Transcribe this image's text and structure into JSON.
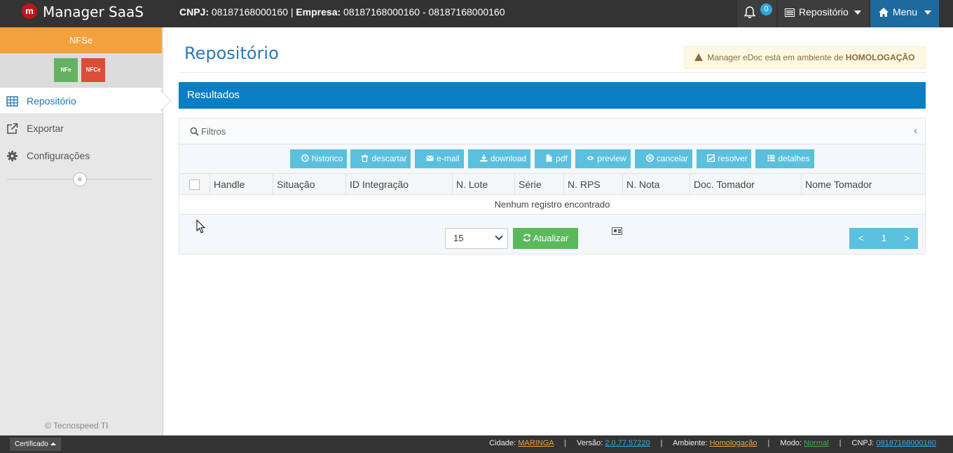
{
  "topbar": {
    "logo_letter": "m",
    "app_title": "Manager SaaS",
    "cnpj_label": "CNPJ:",
    "cnpj_value": "08187168000160",
    "separator": "|",
    "company_label": "Empresa:",
    "company_value": "08187168000160 - 08187168000160",
    "notification_count": "0",
    "repo_label": "Repositório",
    "menu_label": "Menu"
  },
  "sidebar": {
    "doc_type": "NFSe",
    "doc_buttons": [
      {
        "label": "NFe",
        "color": "#62b262"
      },
      {
        "label": "NFCe",
        "color": "#dd4b39"
      }
    ],
    "items": [
      {
        "label": "Repositório",
        "icon": "table-icon",
        "active": true
      },
      {
        "label": "Exportar",
        "icon": "external-link-icon",
        "active": false
      },
      {
        "label": "Configurações",
        "icon": "gear-icon",
        "active": false
      }
    ],
    "collapse_glyph": "«",
    "footer": "© Tecnospeed TI"
  },
  "main": {
    "page_title": "Repositório",
    "env_alert": {
      "text": "Manager eDoc está em ambiente de",
      "highlight": "HOMOLOGAÇÃO"
    },
    "panel_title": "Resultados",
    "filters_label": "Filtros",
    "filters_chevron": "‹",
    "actions": [
      {
        "label": "historico",
        "icon": "clock-icon"
      },
      {
        "label": "descartar",
        "icon": "trash-icon"
      },
      {
        "label": "e-mail",
        "icon": "envelope-icon"
      },
      {
        "label": "download",
        "icon": "download-icon"
      },
      {
        "label": "pdf",
        "icon": "file-icon"
      },
      {
        "label": "preview",
        "icon": "eye-icon"
      },
      {
        "label": "cancelar",
        "icon": "times-circle-icon"
      },
      {
        "label": "resolver",
        "icon": "check-square-icon"
      },
      {
        "label": "detalhes",
        "icon": "list-icon"
      }
    ],
    "columns": [
      "Handle",
      "Situação",
      "ID Integração",
      "N. Lote",
      "Série",
      "N. RPS",
      "N. Nota",
      "Doc. Tomador",
      "Nome Tomador"
    ],
    "empty_message": "Nenhum registro encontrado",
    "page_size": "15",
    "refresh_label": "Atualizar",
    "pagination": {
      "prev": "<",
      "current": "1",
      "next": ">"
    }
  },
  "statusbar": {
    "cert_label": "Certificado",
    "city_label": "Cidade:",
    "city_value": "MARINGA",
    "version_label": "Versão:",
    "version_value": "2.0.77.57220",
    "env_label": "Ambiente:",
    "env_value": "Homologação",
    "mode_label": "Modo:",
    "mode_value": "Normal",
    "cnpj_label": "CNPJ:",
    "cnpj_value": "08187168000160"
  },
  "colors": {
    "topbar": "#333333",
    "accent_blue": "#0a7ec2",
    "sidebar_header": "#f3a13c",
    "action_button": "#5bc0de",
    "refresh_button": "#5cb85c"
  }
}
